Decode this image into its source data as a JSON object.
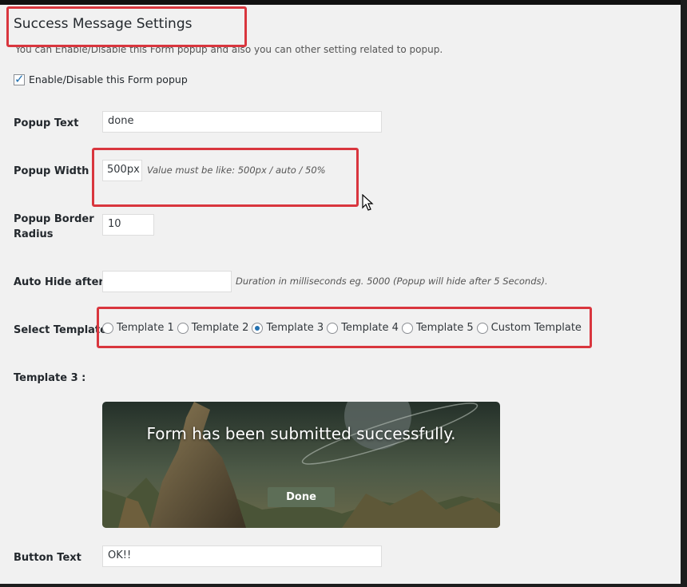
{
  "section": {
    "title": "Success Message Settings",
    "description": "You can Enable/Disable this Form popup and also you can other setting related to popup."
  },
  "enable_popup": {
    "label": "Enable/Disable this Form popup",
    "checked": true
  },
  "fields": {
    "popup_text": {
      "label": "Popup Text",
      "value": "done"
    },
    "popup_width": {
      "label": "Popup Width",
      "value": "500px",
      "hint": "Value must be like: 500px / auto / 50%"
    },
    "border_radius": {
      "label_line1": "Popup Border",
      "label_line2": "Radius",
      "value": "10"
    },
    "auto_hide": {
      "label": "Auto Hide after",
      "value": "",
      "hint": "Duration in milliseconds eg. 5000 (Popup will hide after 5 Seconds)."
    },
    "button_text": {
      "label": "Button Text",
      "value": "OK!!"
    }
  },
  "template": {
    "label": "Select Template",
    "options": [
      "Template 1",
      "Template 2",
      "Template 3",
      "Template 4",
      "Template 5",
      "Custom Template"
    ],
    "selected": "Template 3",
    "preview_label": "Template 3 :",
    "preview_message": "Form has been submitted successfully.",
    "preview_button": "Done"
  },
  "colors": {
    "annotation": "#d9363e",
    "accent": "#2271b1",
    "preview_button": "#5d6e57"
  }
}
